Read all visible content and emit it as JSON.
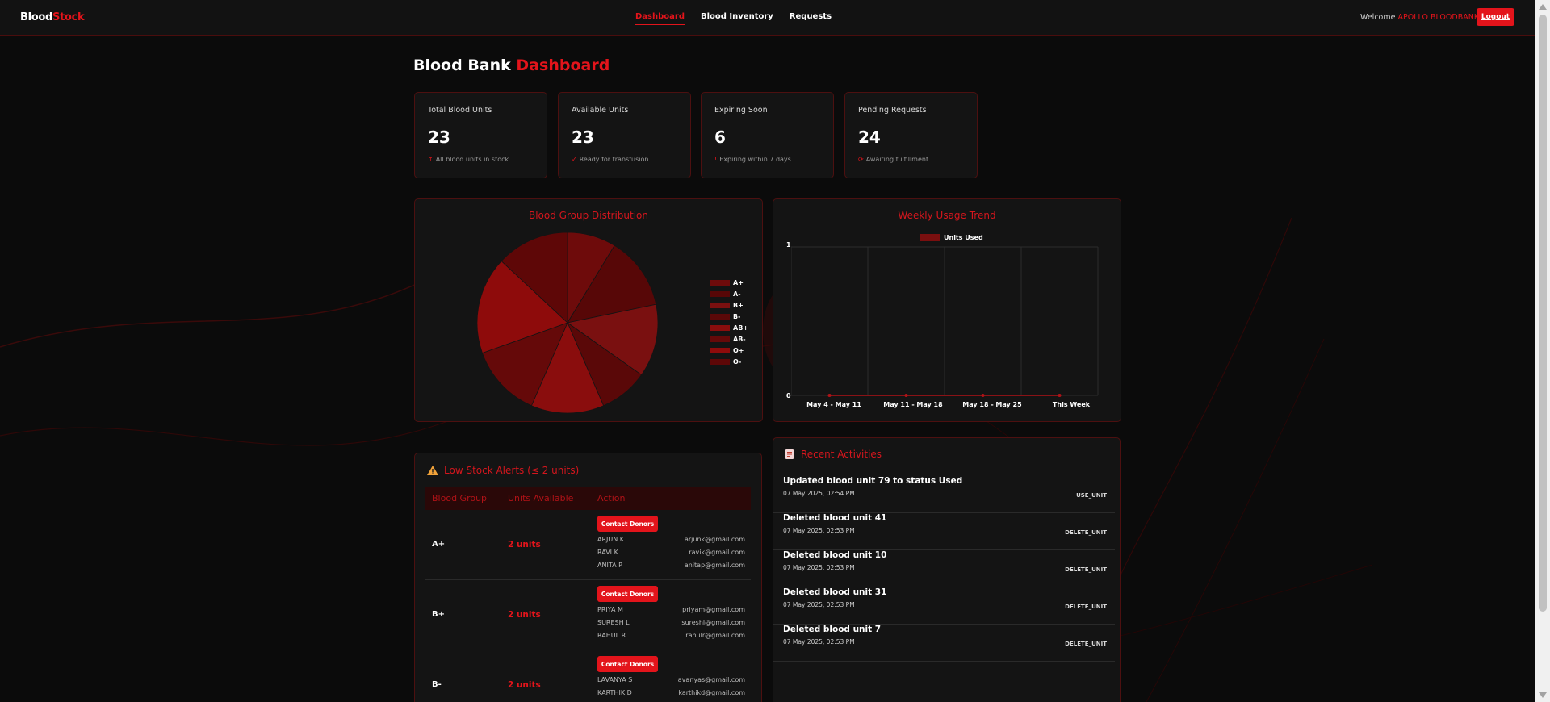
{
  "nav": {
    "brand_part1": "Blood",
    "brand_part2": "Stock",
    "links": [
      "Dashboard",
      "Blood Inventory",
      "Requests"
    ],
    "active_link": "Dashboard",
    "welcome_label": "Welcome",
    "user_name": "APOLLO BLOODBANK",
    "logout_label": "Logout"
  },
  "page": {
    "title_part1": "Blood Bank",
    "title_part2": "Dashboard"
  },
  "stats": [
    {
      "label": "Total Blood Units",
      "value": "23",
      "icon": "↑",
      "note": "All blood units in stock"
    },
    {
      "label": "Available Units",
      "value": "23",
      "icon": "✓",
      "note": "Ready for transfusion"
    },
    {
      "label": "Expiring Soon",
      "value": "6",
      "icon": "!",
      "note": "Expiring within 7 days"
    },
    {
      "label": "Pending Requests",
      "value": "24",
      "icon": "⟳",
      "note": "Awaiting fulfillment"
    }
  ],
  "pie_chart": {
    "title": "Blood Group Distribution",
    "legend": [
      "A+",
      "A-",
      "B+",
      "B-",
      "AB+",
      "AB-",
      "O+",
      "O-"
    ]
  },
  "line_chart": {
    "title": "Weekly Usage Trend",
    "legend_label": "Units Used",
    "y_ticks": [
      "1",
      "0"
    ],
    "x_ticks": [
      "May 4 - May 11",
      "May 11 - May 18",
      "May 18 - May 25",
      "This Week"
    ]
  },
  "chart_data": [
    {
      "type": "pie",
      "title": "Blood Group Distribution",
      "categories": [
        "A+",
        "A-",
        "B+",
        "B-",
        "AB+",
        "AB-",
        "O+",
        "O-"
      ],
      "values": [
        2,
        3,
        3,
        2,
        3,
        3,
        4,
        3
      ],
      "colors": [
        "#6e0b0b",
        "#570707",
        "#7a1010",
        "#5a0808",
        "#8a0d0d",
        "#650909",
        "#8e0b0b",
        "#5e0707"
      ],
      "legend_position": "right"
    },
    {
      "type": "line",
      "title": "Weekly Usage Trend",
      "categories": [
        "May 4 - May 11",
        "May 11 - May 18",
        "May 18 - May 25",
        "This Week"
      ],
      "series": [
        {
          "name": "Units Used",
          "values": [
            0,
            0,
            0,
            0
          ]
        }
      ],
      "ylim": [
        0,
        1
      ],
      "legend_position": "top",
      "grid": true
    }
  ],
  "low_stock": {
    "title": "Low Stock Alerts (≤ 2 units)",
    "headers": [
      "Blood Group",
      "Units Available",
      "Action"
    ],
    "button_label": "Contact Donors",
    "rows": [
      {
        "group": "A+",
        "units": "2 units",
        "donors": [
          {
            "name": "ARJUN K",
            "email": "arjunk@gmail.com"
          },
          {
            "name": "RAVI K",
            "email": "ravik@gmail.com"
          },
          {
            "name": "ANITA P",
            "email": "anitap@gmail.com"
          }
        ]
      },
      {
        "group": "B+",
        "units": "2 units",
        "donors": [
          {
            "name": "PRIYA M",
            "email": "priyam@gmail.com"
          },
          {
            "name": "SURESH L",
            "email": "sureshl@gmail.com"
          },
          {
            "name": "RAHUL R",
            "email": "rahulr@gmail.com"
          }
        ]
      },
      {
        "group": "B-",
        "units": "2 units",
        "donors": [
          {
            "name": "LAVANYA S",
            "email": "lavanyas@gmail.com"
          },
          {
            "name": "KARTHIK D",
            "email": "karthikd@gmail.com"
          }
        ]
      }
    ]
  },
  "activities": {
    "title": "Recent Activities",
    "items": [
      {
        "text": "Updated blood unit 79 to status Used",
        "time": "07 May 2025, 02:54 PM",
        "type": "USE_UNIT"
      },
      {
        "text": "Deleted blood unit 41",
        "time": "07 May 2025, 02:53 PM",
        "type": "DELETE_UNIT"
      },
      {
        "text": "Deleted blood unit 10",
        "time": "07 May 2025, 02:53 PM",
        "type": "DELETE_UNIT"
      },
      {
        "text": "Deleted blood unit 31",
        "time": "07 May 2025, 02:53 PM",
        "type": "DELETE_UNIT"
      },
      {
        "text": "Deleted blood unit 7",
        "time": "07 May 2025, 02:53 PM",
        "type": "DELETE_UNIT"
      }
    ]
  }
}
